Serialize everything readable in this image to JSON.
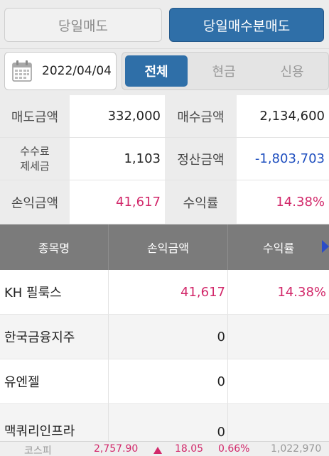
{
  "top_tabs": {
    "tab1": "당일매도",
    "tab2": "당일매수분매도"
  },
  "filter": {
    "date": "2022/04/04",
    "options": [
      "전체",
      "현금",
      "신용"
    ],
    "selected": "전체"
  },
  "summary": {
    "sell_amount_label": "매도금액",
    "sell_amount": "332,000",
    "buy_amount_label": "매수금액",
    "buy_amount": "2,134,600",
    "fee_tax_label_line1": "수수료",
    "fee_tax_label_line2": "제세금",
    "fee_tax": "1,103",
    "settlement_label": "정산금액",
    "settlement": "-1,803,703",
    "profit_label": "손익금액",
    "profit": "41,617",
    "return_label": "수익률",
    "return_rate": "14.38%"
  },
  "list": {
    "headers": [
      "종목명",
      "손익금액",
      "수익률"
    ],
    "rows": [
      {
        "name": "KH 필룩스",
        "profit": "41,617",
        "rate": "14.38%"
      },
      {
        "name": "한국금융지주",
        "profit": "0",
        "rate": ""
      },
      {
        "name": "유엔젤",
        "profit": "0",
        "rate": ""
      },
      {
        "name": "맥쿼리인프라",
        "profit": "0",
        "rate": ""
      }
    ]
  },
  "ticker": {
    "index_name": "코스피",
    "value": "2,757.90",
    "change": "18.05",
    "change_pct": "0.66%",
    "volume": "1,022,970"
  },
  "colors": {
    "accent": "#2f6fa8",
    "positive": "#d2286a",
    "negative": "#1f4fbf",
    "header_bg": "#7b7b7b"
  }
}
